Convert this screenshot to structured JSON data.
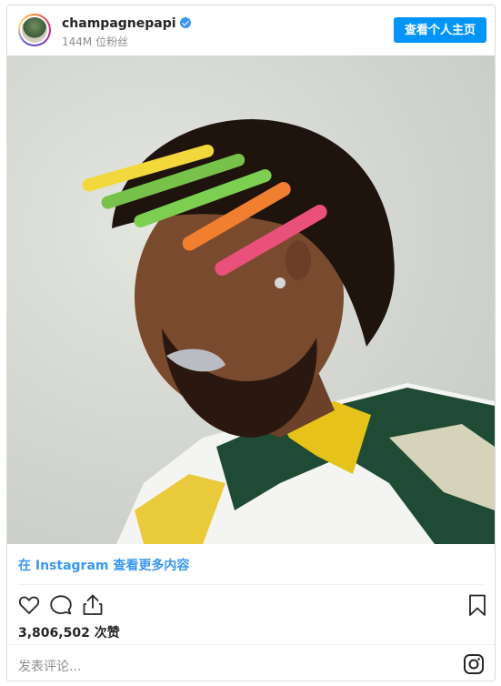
{
  "header": {
    "username": "champagnepapi",
    "followers": "144M 位粉丝",
    "profile_button": "查看个人主页"
  },
  "post": {
    "view_more": "在 Instagram 查看更多内容",
    "likes": "3,806,502 次赞",
    "comment_placeholder": "发表评论..."
  },
  "icons": {
    "like": "heart-icon",
    "comment": "comment-bubble-icon",
    "share": "share-icon",
    "save": "bookmark-icon",
    "brand": "instagram-icon",
    "verified": "verified-badge-icon"
  },
  "colors": {
    "accent": "#0095f6",
    "link": "#3897f0",
    "text": "#262626",
    "muted": "#8e8e8e"
  }
}
